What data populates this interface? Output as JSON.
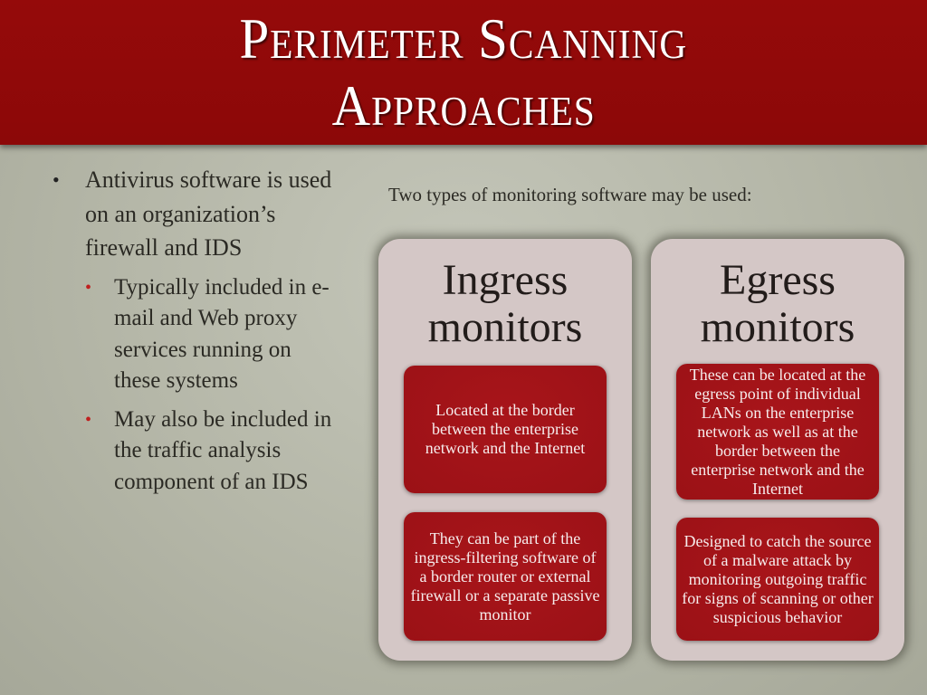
{
  "slide": {
    "title_lines": [
      "Perimeter Scanning",
      "Approaches"
    ],
    "left_bullets": {
      "main": "Antivirus software is used on an organization’s firewall and IDS",
      "sub": [
        "Typically included in e-mail and Web proxy services running on these systems",
        "May also be included in the traffic analysis component of an IDS"
      ]
    },
    "intro": "Two types of monitoring software may be used:",
    "panels": [
      {
        "title": "Ingress monitors",
        "cards": [
          "Located at the border between the enterprise network and the Internet",
          "They can be part of the ingress-filtering software of a border router or external firewall or a separate passive monitor"
        ]
      },
      {
        "title": "Egress monitors",
        "cards": [
          "These can be located at the egress point of individual LANs on the enterprise network as well as at the border between the enterprise network and the Internet",
          "Designed to catch the source of a malware attack by monitoring outgoing traffic for signs of scanning or other suspicious behavior"
        ]
      }
    ],
    "colors": {
      "title_bar": "#950a0a",
      "card": "#a8151a",
      "panel": "#d4c7c6",
      "background": "#b4b6a7",
      "sub_bullet": "#c0201f"
    }
  }
}
